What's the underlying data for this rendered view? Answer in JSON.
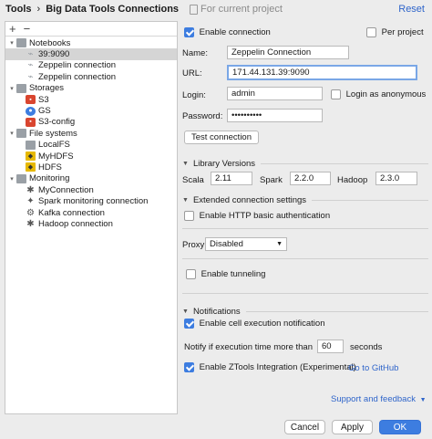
{
  "header": {
    "crumb_root": "Tools",
    "crumb_sep": "›",
    "crumb_page": "Big Data Tools Connections",
    "scope": "For current project",
    "reset": "Reset"
  },
  "tree_toolbar": {
    "add": "+",
    "remove": "−"
  },
  "tree": [
    {
      "label": "Notebooks",
      "level": 0,
      "caret": "▾",
      "icon": "folder-icon",
      "cls": "i-folder",
      "glyph": "",
      "selected": false
    },
    {
      "label": "39:9090",
      "level": 1,
      "caret": "",
      "icon": "notebook-icon",
      "cls": "i-leaf",
      "glyph": "⌁",
      "selected": true
    },
    {
      "label": "Zeppelin connection",
      "level": 1,
      "caret": "",
      "icon": "notebook-icon",
      "cls": "i-leaf",
      "glyph": "⌁",
      "selected": false
    },
    {
      "label": "Zeppelin connection",
      "level": 1,
      "caret": "",
      "icon": "notebook-icon",
      "cls": "i-leaf",
      "glyph": "⌁",
      "selected": false
    },
    {
      "label": "Storages",
      "level": 0,
      "caret": "▾",
      "icon": "folder-icon",
      "cls": "i-folder",
      "glyph": "",
      "selected": false
    },
    {
      "label": "S3",
      "level": 1,
      "caret": "",
      "icon": "s3-icon",
      "cls": "i-red",
      "glyph": "▪",
      "selected": false
    },
    {
      "label": "GS",
      "level": 1,
      "caret": "",
      "icon": "gcs-icon",
      "cls": "i-blue",
      "glyph": "●",
      "selected": false
    },
    {
      "label": "S3-config",
      "level": 1,
      "caret": "",
      "icon": "s3-icon",
      "cls": "i-red",
      "glyph": "▪",
      "selected": false
    },
    {
      "label": "File systems",
      "level": 0,
      "caret": "▾",
      "icon": "folder-icon",
      "cls": "i-folder",
      "glyph": "",
      "selected": false
    },
    {
      "label": "LocalFS",
      "level": 1,
      "caret": "",
      "icon": "local-folder-icon",
      "cls": "i-folder",
      "glyph": "",
      "selected": false
    },
    {
      "label": "MyHDFS",
      "level": 1,
      "caret": "",
      "icon": "hdfs-icon",
      "cls": "i-yel",
      "glyph": "◆",
      "selected": false
    },
    {
      "label": "HDFS",
      "level": 1,
      "caret": "",
      "icon": "hdfs-icon",
      "cls": "i-yel",
      "glyph": "◆",
      "selected": false
    },
    {
      "label": "Monitoring",
      "level": 0,
      "caret": "▾",
      "icon": "folder-icon",
      "cls": "i-folder",
      "glyph": "",
      "selected": false
    },
    {
      "label": "MyConnection",
      "level": 1,
      "caret": "",
      "icon": "monitoring-icon",
      "cls": "i-gray",
      "glyph": "✱",
      "selected": false
    },
    {
      "label": "Spark monitoring connection",
      "level": 1,
      "caret": "",
      "icon": "spark-icon",
      "cls": "i-gray",
      "glyph": "✦",
      "selected": false
    },
    {
      "label": "Kafka connection",
      "level": 1,
      "caret": "",
      "icon": "kafka-icon",
      "cls": "i-gray",
      "glyph": "⚙",
      "selected": false
    },
    {
      "label": "Hadoop connection",
      "level": 1,
      "caret": "",
      "icon": "hadoop-icon",
      "cls": "i-gray",
      "glyph": "✱",
      "selected": false
    }
  ],
  "form": {
    "enable_connection": "Enable connection",
    "per_project": "Per project",
    "name_label": "Name:",
    "name_value": "Zeppelin Connection",
    "url_label": "URL:",
    "url_value": "171.44.131.39:9090",
    "login_label": "Login:",
    "login_value": "admin",
    "anonymous": "Login as anonymous",
    "password_label": "Password:",
    "password_value": "••••••••••",
    "test_connection": "Test connection",
    "library_versions": "Library Versions",
    "scala_label": "Scala",
    "scala_value": "2.11",
    "spark_label": "Spark",
    "spark_value": "2.2.0",
    "hadoop_label": "Hadoop",
    "hadoop_value": "2.3.0",
    "extended": "Extended connection settings",
    "http_auth": "Enable HTTP basic authentication",
    "proxy_label": "Proxy",
    "proxy_value": "Disabled",
    "tunneling": "Enable tunneling",
    "notifications": "Notifications",
    "cell_notify": "Enable cell execution notification",
    "notify_prefix": "Notify if execution time more than",
    "notify_value": "60",
    "notify_suffix": "seconds",
    "ztools": "Enable ZTools Integration (Experimental)",
    "github": "Go to GitHub",
    "support": "Support and feedback"
  },
  "footer": {
    "cancel": "Cancel",
    "apply": "Apply",
    "ok": "OK"
  },
  "colors": {
    "accent": "#3d7de0",
    "link": "#2f65ca",
    "selection": "#d5d5d5"
  }
}
